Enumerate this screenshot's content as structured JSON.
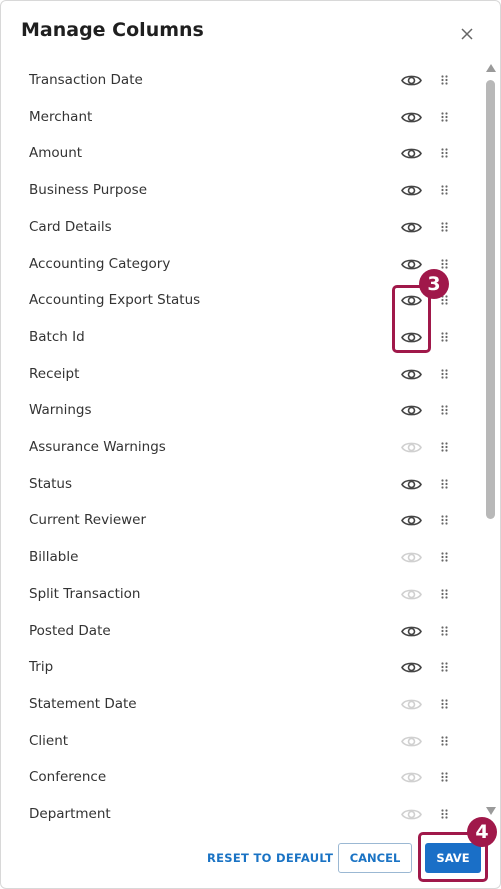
{
  "dialog": {
    "title": "Manage Columns",
    "close_icon": "close-icon"
  },
  "columns": [
    {
      "label": "Transaction Date",
      "visible": true
    },
    {
      "label": "Merchant",
      "visible": true
    },
    {
      "label": "Amount",
      "visible": true
    },
    {
      "label": "Business Purpose",
      "visible": true
    },
    {
      "label": "Card Details",
      "visible": true
    },
    {
      "label": "Accounting Category",
      "visible": true
    },
    {
      "label": "Accounting Export Status",
      "visible": true
    },
    {
      "label": "Batch Id",
      "visible": true
    },
    {
      "label": "Receipt",
      "visible": true
    },
    {
      "label": "Warnings",
      "visible": true
    },
    {
      "label": "Assurance Warnings",
      "visible": false
    },
    {
      "label": "Status",
      "visible": true
    },
    {
      "label": "Current Reviewer",
      "visible": true
    },
    {
      "label": "Billable",
      "visible": false
    },
    {
      "label": "Split Transaction",
      "visible": false
    },
    {
      "label": "Posted Date",
      "visible": true
    },
    {
      "label": "Trip",
      "visible": true
    },
    {
      "label": "Statement Date",
      "visible": false
    },
    {
      "label": "Client",
      "visible": false
    },
    {
      "label": "Conference",
      "visible": false
    },
    {
      "label": "Department",
      "visible": false
    }
  ],
  "footer": {
    "reset_label": "RESET TO DEFAULT",
    "cancel_label": "CANCEL",
    "save_label": "SAVE"
  },
  "callouts": {
    "eye_group": "3",
    "save": "4"
  },
  "colors": {
    "accent": "#1a6fc7",
    "link": "#1a73c4",
    "callout": "#a0184a",
    "eye_on": "#444444",
    "eye_off": "#d0d0d0"
  }
}
